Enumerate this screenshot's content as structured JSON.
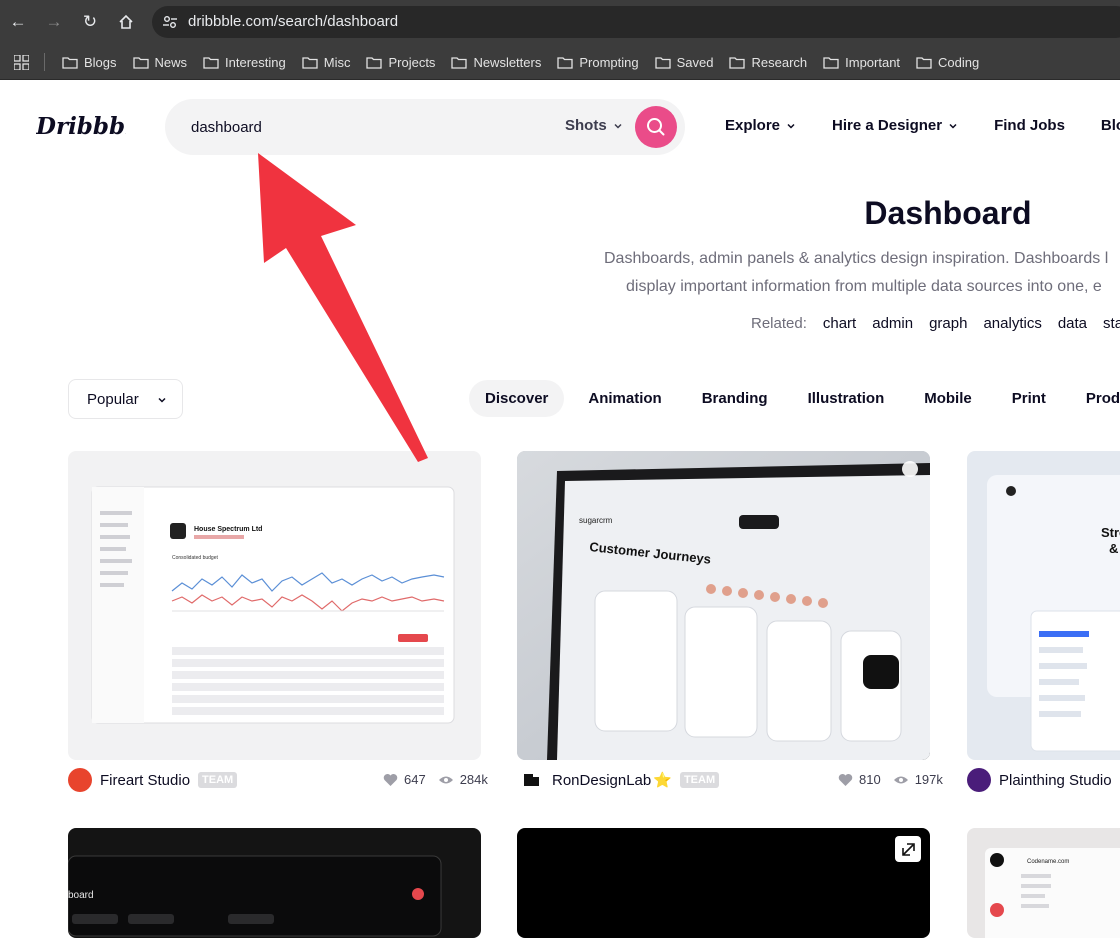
{
  "browser": {
    "url": "dribbble.com/search/dashboard",
    "bookmarks": [
      "Blogs",
      "News",
      "Interesting",
      "Misc",
      "Projects",
      "Newsletters",
      "Prompting",
      "Saved",
      "Research",
      "Important",
      "Coding"
    ]
  },
  "header": {
    "logo": "Dribbble",
    "search_value": "dashboard",
    "search_scope": "Shots",
    "nav": [
      "Explore",
      "Hire a Designer",
      "Find Jobs",
      "Blog"
    ]
  },
  "hero": {
    "title": "Dashboard",
    "desc_line1": "Dashboards, admin panels & analytics design inspiration. Dashboards l",
    "desc_line2": "display important information from multiple data sources into one, e",
    "related_label": "Related:",
    "related_tags": [
      "chart",
      "admin",
      "graph",
      "analytics",
      "data",
      "stat"
    ]
  },
  "filters": {
    "sort": "Popular",
    "categories": [
      "Discover",
      "Animation",
      "Branding",
      "Illustration",
      "Mobile",
      "Print",
      "Product"
    ]
  },
  "shots": [
    {
      "author": "Fireart Studio",
      "badge": "TEAM",
      "likes": "647",
      "views": "284k",
      "avatar_color": "#e8442d"
    },
    {
      "author": "RonDesignLab",
      "star": "⭐",
      "badge": "TEAM",
      "likes": "810",
      "views": "197k",
      "avatar_color": "#ffffff"
    },
    {
      "author": "Plainthing Studio",
      "avatar_color": "#4a1d7a"
    }
  ],
  "shot_preview_text": {
    "s1_title": "House Spectrum Ltd",
    "s1_sub": "Consolidated budget",
    "s2_title": "Customer Journeys",
    "s2_brand": "sugarcrm",
    "s3_title1": "Stream",
    "s3_title2": "& Proj",
    "s4_title": "board",
    "s6_brand": "Codename.com"
  },
  "colors": {
    "accent": "#ea4c89",
    "arrow": "#f0333f"
  }
}
